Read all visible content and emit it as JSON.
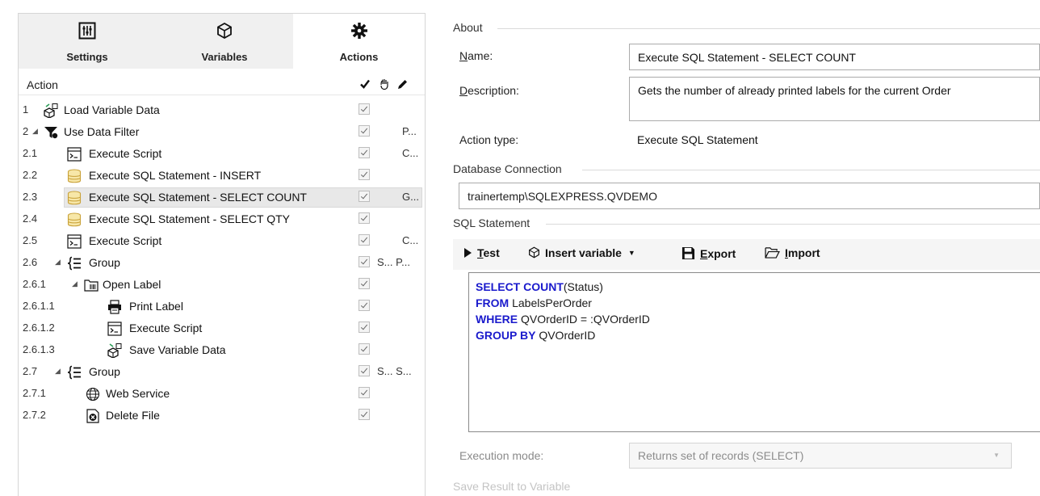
{
  "tabs": [
    {
      "label": "Settings",
      "icon": "settings-sliders-icon",
      "active": false
    },
    {
      "label": "Variables",
      "icon": "variables-cube-icon",
      "active": false
    },
    {
      "label": "Actions",
      "icon": "gear-icon",
      "active": true
    }
  ],
  "tree": {
    "header": {
      "action": "Action",
      "col_enabled": "checkmark-icon",
      "col_error": "hand-icon",
      "col_description": "pencil-icon"
    },
    "rows": [
      {
        "num": "1",
        "label": "Load Variable Data",
        "icon": "load-variable-icon",
        "extra": ""
      },
      {
        "num": "2",
        "label": "Use Data Filter",
        "icon": "filter-icon",
        "extra": "P..."
      },
      {
        "num": "2.1",
        "label": "Execute Script",
        "icon": "script-icon",
        "extra": "C..."
      },
      {
        "num": "2.2",
        "label": "Execute SQL Statement - INSERT",
        "icon": "database-icon",
        "extra": ""
      },
      {
        "num": "2.3",
        "label": "Execute SQL Statement - SELECT COUNT",
        "icon": "database-icon",
        "extra": "G...",
        "selected": true
      },
      {
        "num": "2.4",
        "label": "Execute SQL Statement - SELECT QTY",
        "icon": "database-icon",
        "extra": ""
      },
      {
        "num": "2.5",
        "label": "Execute Script",
        "icon": "script-icon",
        "extra": "C..."
      },
      {
        "num": "2.6",
        "label": "Group",
        "icon": "group-brace-icon",
        "extra": "S... P..."
      },
      {
        "num": "2.6.1",
        "label": "Open Label",
        "icon": "open-label-icon",
        "extra": ""
      },
      {
        "num": "2.6.1.1",
        "label": "Print Label",
        "icon": "printer-icon",
        "extra": ""
      },
      {
        "num": "2.6.1.2",
        "label": "Execute Script",
        "icon": "script-icon",
        "extra": ""
      },
      {
        "num": "2.6.1.3",
        "label": "Save Variable Data",
        "icon": "save-variable-icon",
        "extra": ""
      },
      {
        "num": "2.7",
        "label": "Group",
        "icon": "group-brace-icon",
        "extra": "S... S..."
      },
      {
        "num": "2.7.1",
        "label": "Web Service",
        "icon": "globe-icon",
        "extra": ""
      },
      {
        "num": "2.7.2",
        "label": "Delete File",
        "icon": "delete-file-icon",
        "extra": ""
      }
    ]
  },
  "about": {
    "section_title": "About",
    "name_label": "Name:",
    "name_value": "Execute SQL Statement - SELECT COUNT",
    "description_label": "Description:",
    "description_value": "Gets the number of already printed labels for the current Order",
    "action_type_label": "Action type:",
    "action_type_value": "Execute SQL Statement"
  },
  "db": {
    "section_title": "Database Connection",
    "connection_value": "trainertemp\\SQLEXPRESS.QVDEMO"
  },
  "sql": {
    "section_title": "SQL Statement",
    "toolbar": {
      "test": "Test",
      "insert_variable": "Insert variable",
      "export": "Export",
      "import": "Import"
    },
    "lines": [
      {
        "kw": "SELECT COUNT",
        "rest": "(Status)"
      },
      {
        "kw": "FROM",
        "rest": " LabelsPerOrder"
      },
      {
        "kw": "WHERE",
        "rest": " QVOrderID = :QVOrderID"
      },
      {
        "kw": "GROUP BY",
        "rest": " QVOrderID"
      }
    ],
    "execution_mode_label": "Execution mode:",
    "execution_mode_value": "Returns set of records (SELECT)",
    "save_result_label": "Save Result to Variable"
  },
  "colors": {
    "keyword": "#1a1acc",
    "icon_yellow": "#d9b84a",
    "selected_row": "#e8e8e8"
  }
}
